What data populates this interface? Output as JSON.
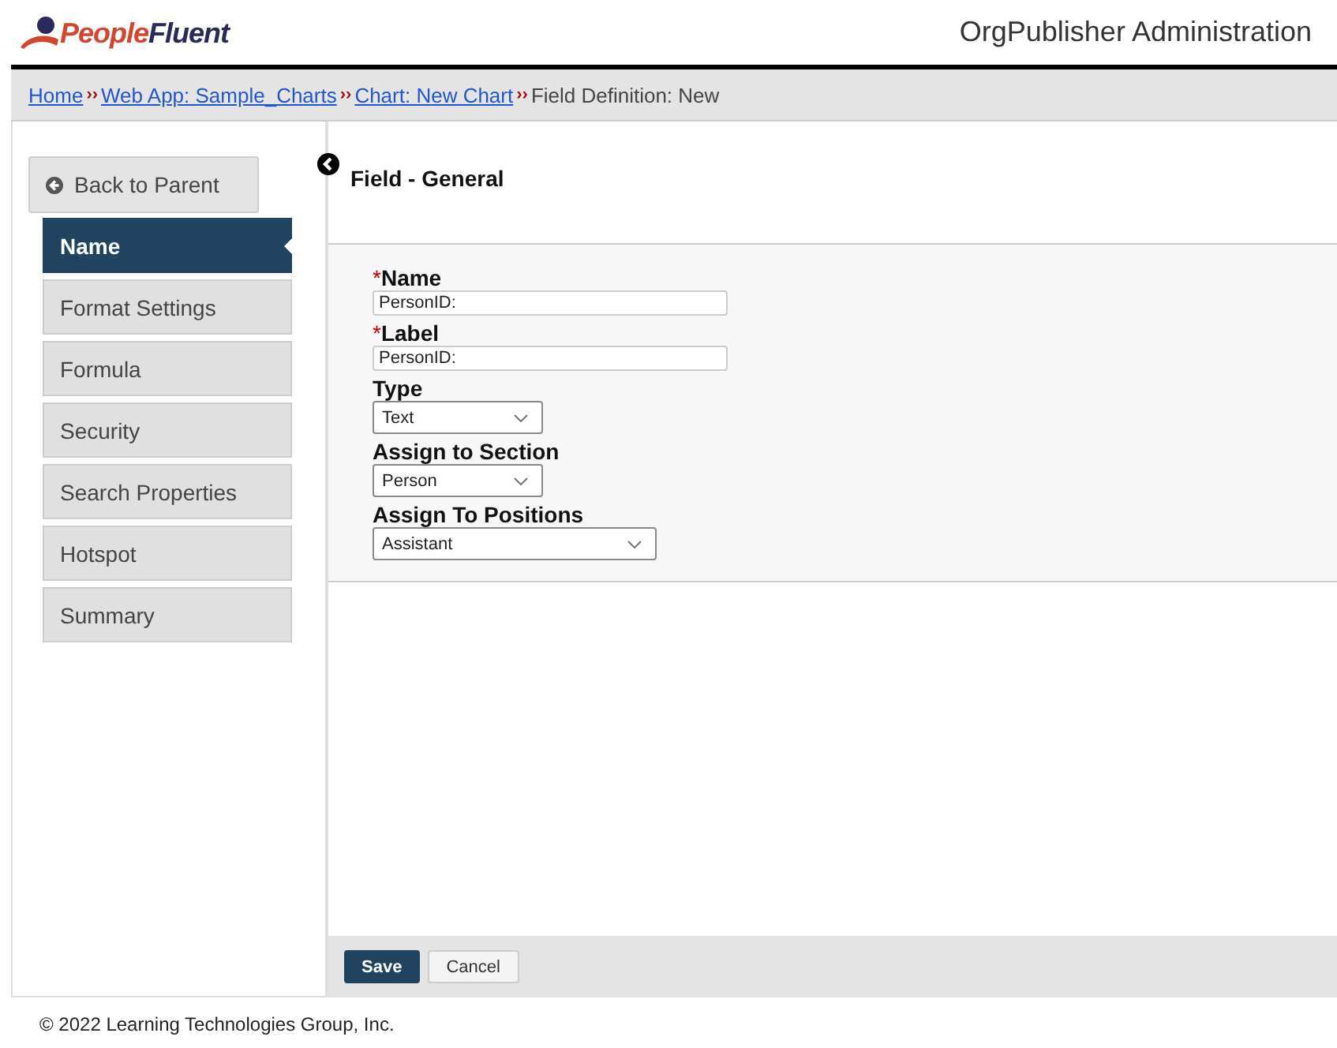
{
  "header": {
    "logo": {
      "first": "People",
      "second": "Fluent"
    },
    "title": "OrgPublisher Administration"
  },
  "breadcrumb": [
    {
      "kind": "link",
      "text": "Home"
    },
    {
      "kind": "separator",
      "text": "››"
    },
    {
      "kind": "link",
      "text": "Web App: Sample_Charts"
    },
    {
      "kind": "separator",
      "text": "››"
    },
    {
      "kind": "link",
      "text": "Chart: New Chart"
    },
    {
      "kind": "separator",
      "text": "››"
    },
    {
      "kind": "text",
      "text": "Field Definition: New"
    }
  ],
  "sidebar": {
    "back": "Back to Parent",
    "items": [
      {
        "label": "Name",
        "selected": true
      },
      {
        "label": "Format Settings",
        "selected": false
      },
      {
        "label": "Formula",
        "selected": false
      },
      {
        "label": "Security",
        "selected": false
      },
      {
        "label": "Search Properties",
        "selected": false
      },
      {
        "label": "Hotspot",
        "selected": false
      },
      {
        "label": "Summary",
        "selected": false
      }
    ]
  },
  "panel": {
    "title": "Field - General",
    "fields": [
      {
        "kind": "text",
        "marker": "*",
        "label": "Name",
        "value": "PersonID:"
      },
      {
        "kind": "text",
        "marker": "*",
        "label": "Label",
        "value": "PersonID:"
      },
      {
        "kind": "select",
        "label": "Type",
        "value": "Text",
        "wide": false
      },
      {
        "kind": "select",
        "label": "Assign to Section",
        "value": "Person",
        "wide": false
      },
      {
        "kind": "select",
        "label": "Assign To Positions",
        "value": "Assistant",
        "wide": true
      }
    ]
  },
  "buttons": [
    {
      "kind": "primary",
      "label": "Save"
    },
    {
      "kind": "secondary",
      "label": "Cancel"
    }
  ],
  "footer": "© 2022 Learning Technologies Group, Inc."
}
